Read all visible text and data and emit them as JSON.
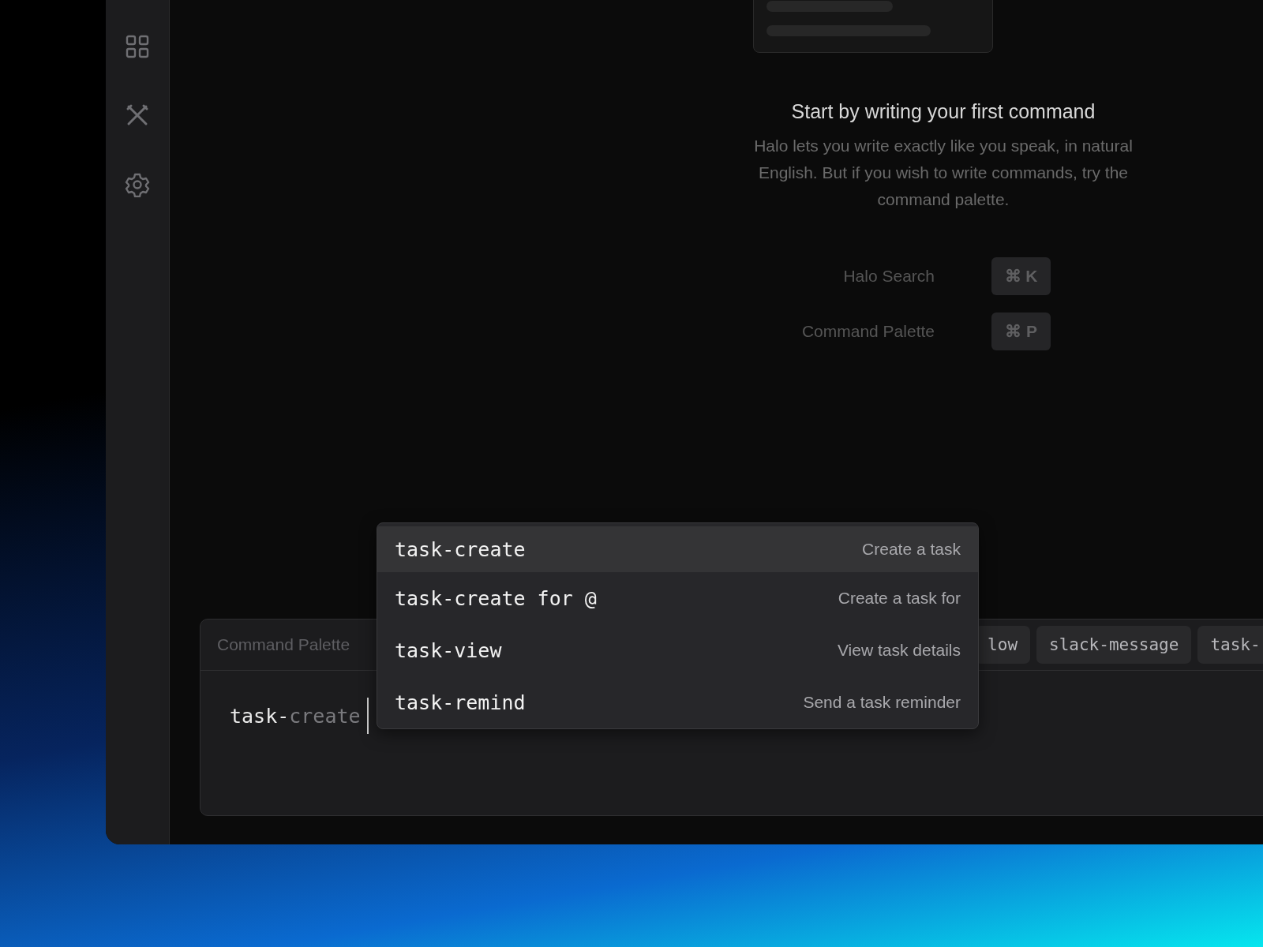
{
  "sidebar": {
    "items": [
      {
        "kind": "grid"
      },
      {
        "kind": "tools"
      },
      {
        "kind": "settings"
      }
    ]
  },
  "empty_state": {
    "title": "Start by writing your first command",
    "description": "Halo lets you write exactly like you speak, in natural English. But if you wish to write commands, try the command palette.",
    "shortcuts": [
      {
        "label": "Halo Search",
        "keys": "⌘ K"
      },
      {
        "label": "Command Palette",
        "keys": "⌘ P"
      }
    ]
  },
  "command_palette": {
    "title": "Command Palette",
    "chips": [
      "low",
      "slack-message",
      "task-"
    ],
    "input": {
      "value": "task-",
      "suggestion": "create"
    },
    "suggestions": [
      {
        "command": "task-create",
        "description": "Create a task",
        "selected": true
      },
      {
        "command": "task-create for @",
        "description": "Create a task for",
        "selected": false
      },
      {
        "command": "task-view",
        "description": "View task details",
        "selected": false
      },
      {
        "command": "task-remind",
        "description": "Send a task reminder",
        "selected": false
      }
    ]
  }
}
